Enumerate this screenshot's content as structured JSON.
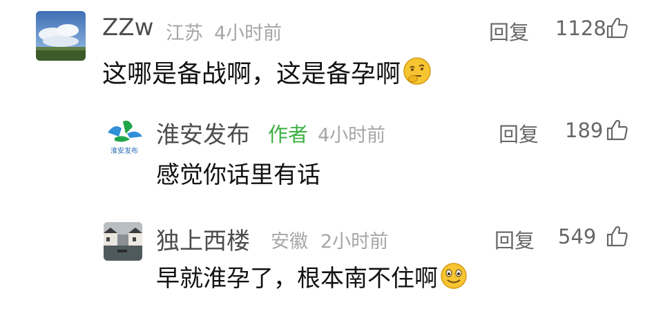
{
  "comments": [
    {
      "user": "ZZw",
      "location": "江苏",
      "time": "4小时前",
      "reply_label": "回复",
      "likes": "1128",
      "text": "这哪是备战啊，这是备孕啊",
      "emoji": "thinking-face-emoji"
    },
    {
      "user": "淮安发布",
      "author_tag": "作者",
      "time": "4小时前",
      "reply_label": "回复",
      "likes": "189",
      "text": "感觉你话里有话",
      "avatar_text": "淮安发布"
    },
    {
      "user": "独上西楼",
      "location": "安徽",
      "time": "2小时前",
      "reply_label": "回复",
      "likes": "549",
      "text": "早就淮孕了，根本南不住啊",
      "emoji": "smiling-face-emoji"
    }
  ],
  "colors": {
    "name": "#4d4d4d",
    "meta": "#a6a6a6",
    "author_tag": "#3cb043",
    "content": "#111111"
  }
}
